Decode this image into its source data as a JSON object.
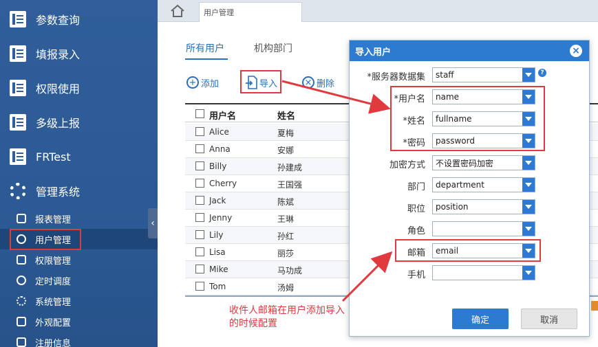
{
  "sidebar": {
    "top_items": [
      {
        "label": "参数查询",
        "icon": "report-icon"
      },
      {
        "label": "填报录入",
        "icon": "report-icon"
      },
      {
        "label": "权限使用",
        "icon": "report-icon"
      },
      {
        "label": "多级上报",
        "icon": "report-icon"
      },
      {
        "label": "FRTest",
        "icon": "report-icon"
      },
      {
        "label": "管理系统",
        "icon": "gear-icon"
      }
    ],
    "sub_items": [
      {
        "label": "报表管理",
        "icon": "report-manage-icon"
      },
      {
        "label": "用户管理",
        "icon": "user-icon",
        "active": true
      },
      {
        "label": "权限管理",
        "icon": "permission-icon"
      },
      {
        "label": "定时调度",
        "icon": "clock-icon"
      },
      {
        "label": "系统管理",
        "icon": "gear-icon"
      },
      {
        "label": "外观配置",
        "icon": "palette-icon"
      },
      {
        "label": "注册信息",
        "icon": "register-icon"
      }
    ],
    "collapse_glyph": "‹"
  },
  "tabs": {
    "page_tab_label": "用户管理"
  },
  "content": {
    "subtabs": [
      "所有用户",
      "机构部门"
    ],
    "toolbar": {
      "add": "添加",
      "import": "导入",
      "delete": "删除"
    },
    "table": {
      "headers": [
        "用户名",
        "姓名"
      ],
      "rows": [
        {
          "username": "Alice",
          "fullname": "夏梅"
        },
        {
          "username": "Anna",
          "fullname": "安娜"
        },
        {
          "username": "Billy",
          "fullname": "孙建成"
        },
        {
          "username": "Cherry",
          "fullname": "王国强"
        },
        {
          "username": "Jack",
          "fullname": "陈斌"
        },
        {
          "username": "Jenny",
          "fullname": "王琳"
        },
        {
          "username": "Lily",
          "fullname": "孙红"
        },
        {
          "username": "Lisa",
          "fullname": "丽莎"
        },
        {
          "username": "Mike",
          "fullname": "马功成"
        },
        {
          "username": "Tom",
          "fullname": "汤姆"
        }
      ]
    },
    "annotation": "收件人邮箱在用户添加导入的时候配置"
  },
  "dialog": {
    "title": "导入用户",
    "fields": [
      {
        "label": "*服务器数据集",
        "value": "staff"
      },
      {
        "label": "*用户名",
        "value": "name"
      },
      {
        "label": "*姓名",
        "value": "fullname"
      },
      {
        "label": "*密码",
        "value": "password"
      },
      {
        "label": "加密方式",
        "value": "不设置密码加密"
      },
      {
        "label": "部门",
        "value": "department"
      },
      {
        "label": "职位",
        "value": "position"
      },
      {
        "label": "角色",
        "value": ""
      },
      {
        "label": "邮箱",
        "value": "email"
      },
      {
        "label": "手机",
        "value": ""
      }
    ],
    "help_glyph": "?",
    "ok_label": "确定",
    "cancel_label": "取消"
  },
  "colors": {
    "sidebar": "#2f5e9a",
    "accent": "#2c7bd0",
    "highlight": "#e0393e"
  }
}
